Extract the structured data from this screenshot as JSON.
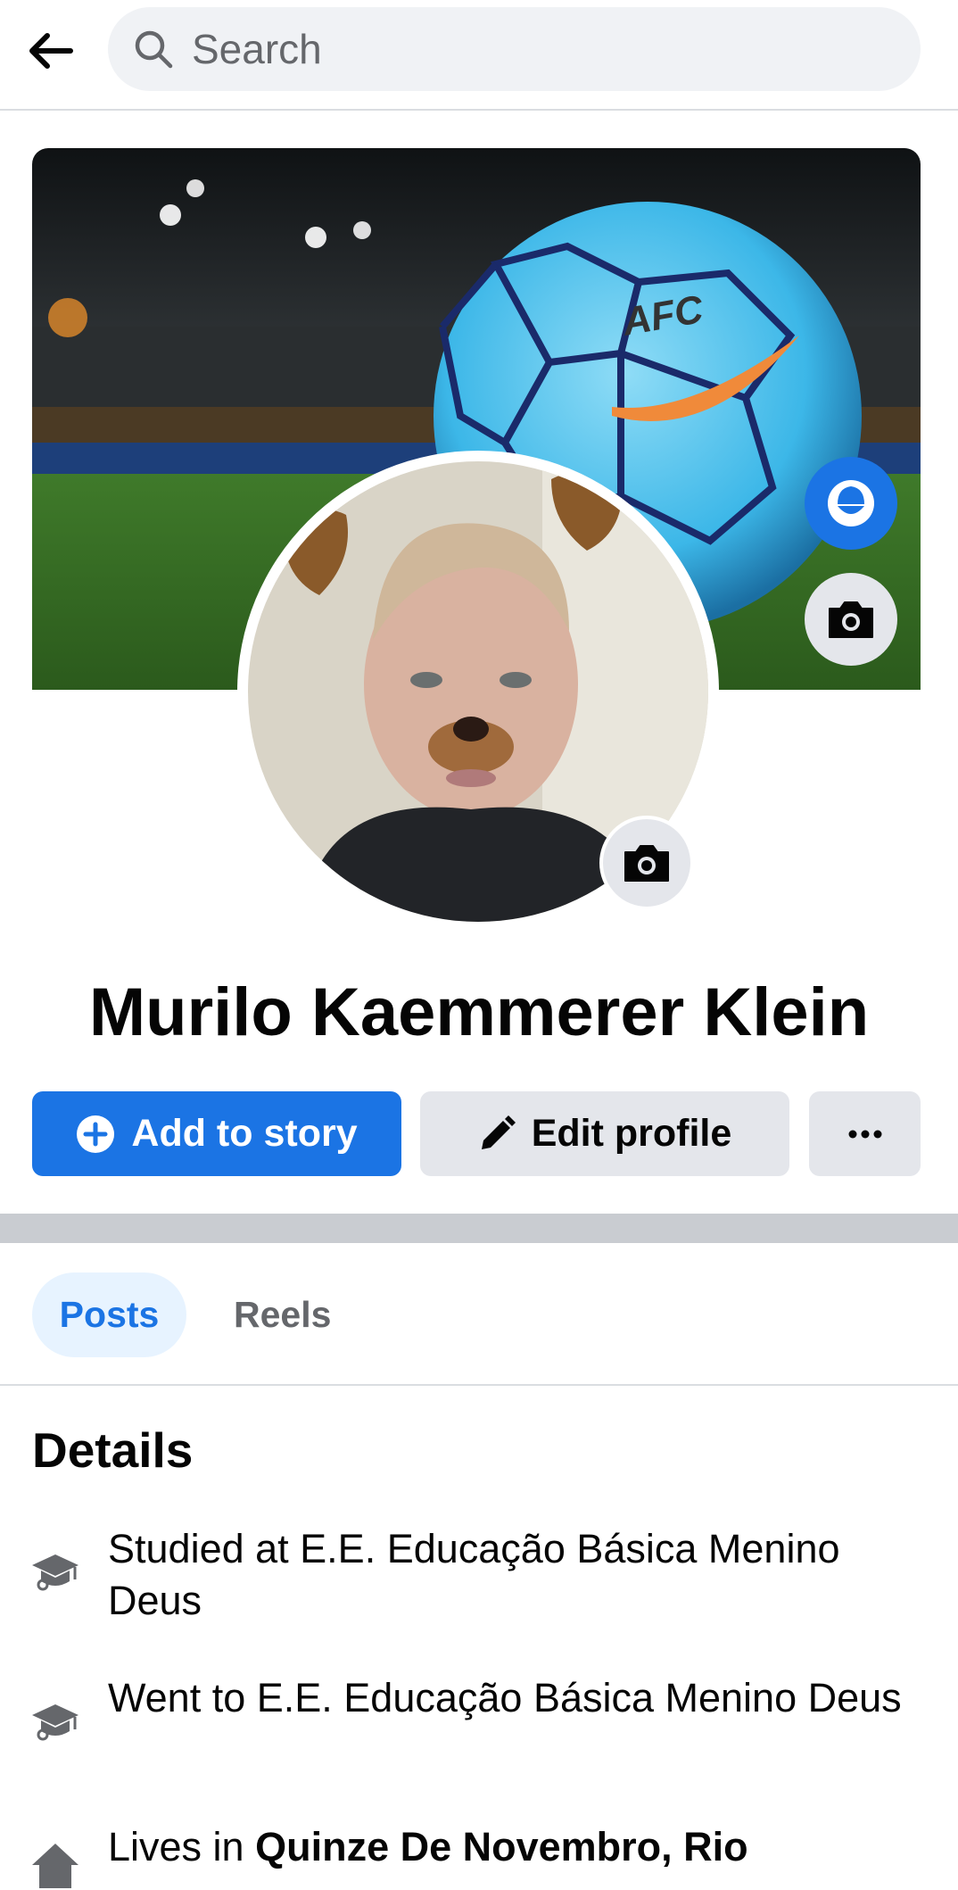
{
  "header": {
    "back_icon": "arrow-left-icon",
    "search_placeholder": "Search"
  },
  "cover": {
    "description_icons": [
      "avatar-icon",
      "camera-icon"
    ]
  },
  "profile": {
    "name": "Murilo Kaemmerer Klein"
  },
  "actions": {
    "add_story_label": "Add to story",
    "edit_profile_label": "Edit profile",
    "more_icon": "more-dots-icon"
  },
  "tabs": [
    {
      "label": "Posts",
      "active": true
    },
    {
      "label": "Reels",
      "active": false
    }
  ],
  "details": {
    "title": "Details",
    "items": [
      {
        "icon": "graduation-cap-icon",
        "prefix": "Studied at E.E. Educação Básica Menino Deus",
        "bold": ""
      },
      {
        "icon": "graduation-cap-icon",
        "prefix": "Went to E.E. Educação Básica Menino Deus",
        "bold": ""
      },
      {
        "icon": "home-icon",
        "prefix": "Lives in ",
        "bold": "Quinze De Novembro, Rio"
      }
    ]
  },
  "colors": {
    "accent": "#1b74e4",
    "button_gray": "#e4e6eb",
    "divider": "#c9ccd1"
  }
}
